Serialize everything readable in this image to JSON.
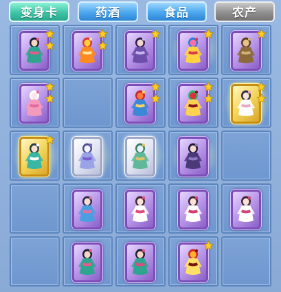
{
  "tabs": [
    {
      "label": "变身卡",
      "state": "active"
    },
    {
      "label": "药酒",
      "state": "normal"
    },
    {
      "label": "食品",
      "state": "normal"
    },
    {
      "label": "农产",
      "state": "disabled"
    }
  ],
  "colors": {
    "tab_active": "#3fc4a8",
    "tab_normal": "#4aa6ee",
    "tab_disabled": "#8f8f8f",
    "cell_bg": "#7da3d6",
    "card_purple": "#8b5fc8",
    "card_gold": "#d9a62b",
    "card_silver": "#b9bfd8",
    "star": "#ffcc22"
  },
  "inventory": [
    [
      {
        "card": "purple",
        "stars": 2,
        "figure": "warrior-girl",
        "glow": false
      },
      {
        "card": "purple",
        "stars": 2,
        "figure": "lion-dance",
        "glow": false
      },
      {
        "card": "purple",
        "stars": 1,
        "figure": "dark-maiden",
        "glow": false
      },
      {
        "card": "purple",
        "stars": 1,
        "figure": "phoenix",
        "glow": true
      },
      {
        "card": "purple",
        "stars": 1,
        "figure": "armored-general",
        "glow": false
      }
    ],
    [
      {
        "card": "purple",
        "stars": 2,
        "figure": "rabbit-maiden",
        "glow": false
      },
      null,
      {
        "card": "purple",
        "stars": 2,
        "figure": "red-beast",
        "glow": false
      },
      {
        "card": "purple",
        "stars": 2,
        "figure": "red-dragon",
        "glow": false
      },
      {
        "card": "gold",
        "stars": 2,
        "figure": "fairy",
        "glow": true
      }
    ],
    [
      {
        "card": "gold",
        "stars": 1,
        "figure": "jade-fairy",
        "glow": true
      },
      {
        "card": "silver",
        "stars": 0,
        "figure": "white-tiger",
        "glow": true
      },
      {
        "card": "silver",
        "stars": 0,
        "figure": "azure-dragon",
        "glow": true
      },
      {
        "card": "purple",
        "stars": 0,
        "figure": "shadow-maiden",
        "glow": true
      },
      null
    ],
    [
      null,
      {
        "card": "purple",
        "stars": 0,
        "figure": "blue-fairy",
        "glow": false
      },
      {
        "card": "purple",
        "stars": 0,
        "figure": "pink-dancer",
        "glow": false
      },
      {
        "card": "purple",
        "stars": 0,
        "figure": "pink-dancer-2",
        "glow": false
      },
      {
        "card": "purple",
        "stars": 0,
        "figure": "pink-dancer-3",
        "glow": false
      }
    ],
    [
      null,
      {
        "card": "purple",
        "stars": 0,
        "figure": "warrior-girl-2",
        "glow": false
      },
      {
        "card": "purple",
        "stars": 0,
        "figure": "warrior-girl-3",
        "glow": false
      },
      {
        "card": "purple",
        "stars": 1,
        "figure": "fire-spirit",
        "glow": false
      },
      null
    ]
  ]
}
